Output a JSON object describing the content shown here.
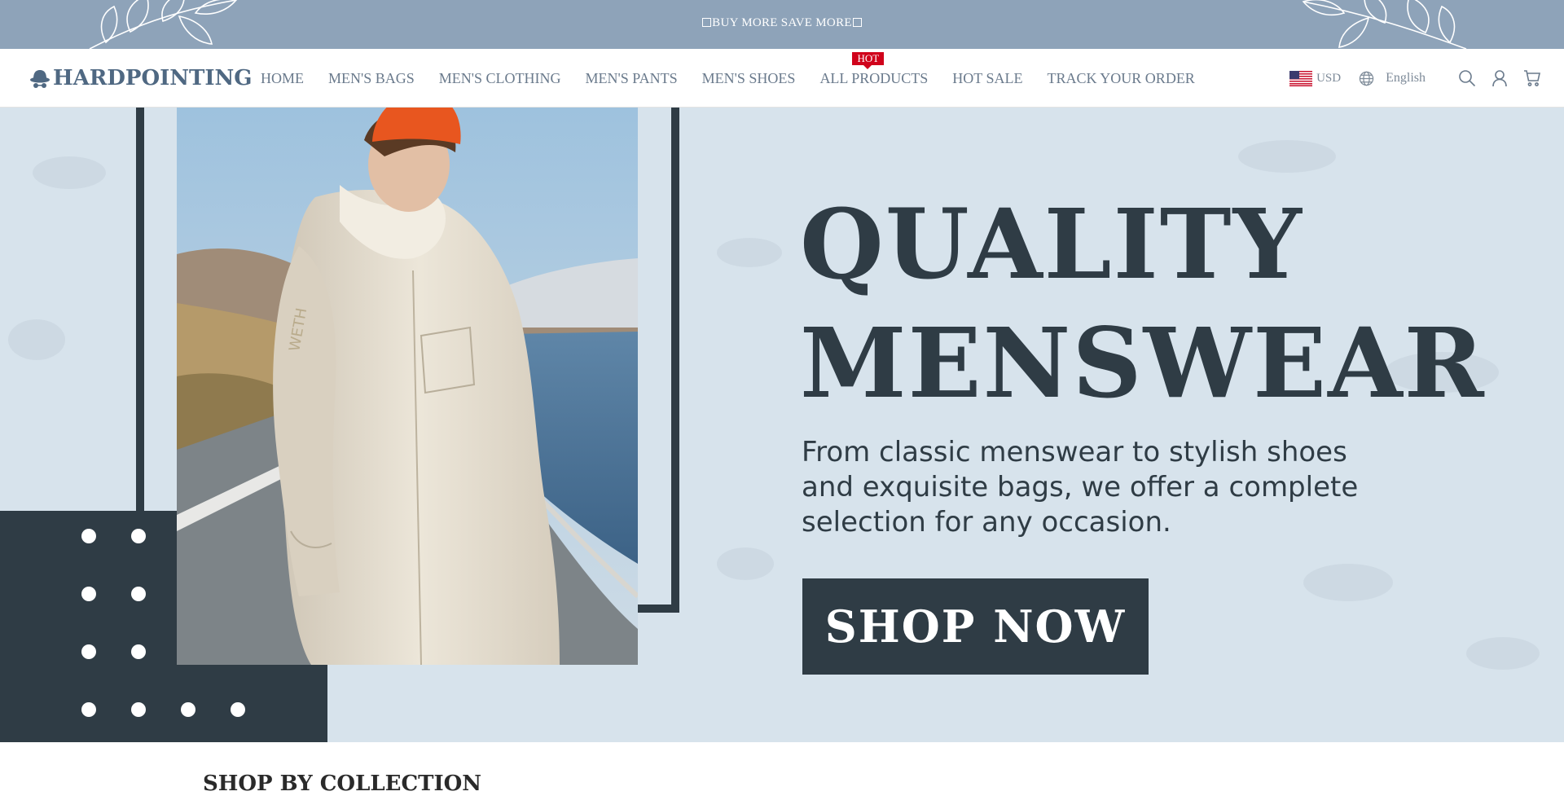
{
  "announcement": {
    "text": "BUY MORE SAVE MORE"
  },
  "brand": {
    "name": "HARDPOINTING",
    "color": "#4f6882"
  },
  "nav": {
    "items": [
      {
        "label": "HOME"
      },
      {
        "label": "MEN'S BAGS"
      },
      {
        "label": "MEN'S CLOTHING"
      },
      {
        "label": "MEN'S PANTS"
      },
      {
        "label": "MEN'S SHOES"
      },
      {
        "label": "ALL PRODUCTS",
        "badge": "HOT"
      },
      {
        "label": "HOT SALE"
      },
      {
        "label": "TRACK YOUR ORDER"
      }
    ]
  },
  "utilities": {
    "currency": "USD",
    "currency_icon": "us-flag-icon",
    "language": "English",
    "language_icon": "globe-icon",
    "icons": [
      "search-icon",
      "account-icon",
      "cart-icon"
    ]
  },
  "hero": {
    "title_line1": "QUALITY",
    "title_line2": "MENSWEAR",
    "subtitle": "From classic menswear to stylish shoes and exquisite bags, we offer a complete selection for any occasion.",
    "cta": "SHOP NOW",
    "accent_dark": "#2f3c45",
    "background": "#d7e3ec"
  },
  "collection": {
    "heading": "SHOP BY COLLECTION"
  }
}
